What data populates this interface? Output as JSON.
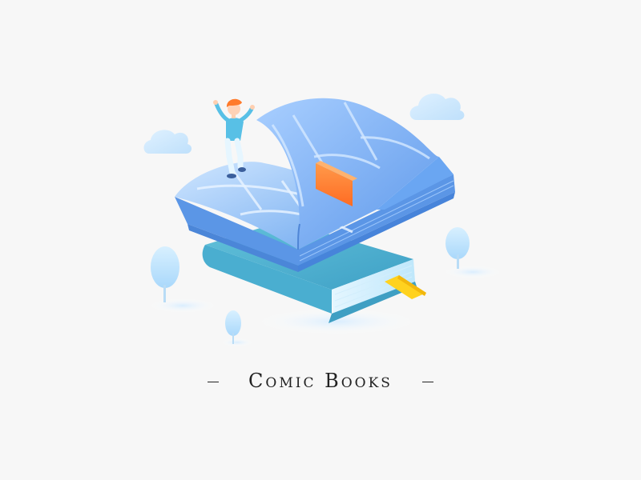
{
  "caption": {
    "title": "Comic Books"
  },
  "colors": {
    "background": "#f7f7f7",
    "book_page": "#6aa8f0",
    "book_closed": "#58bcd8",
    "page_marker": "#ff7a2a",
    "bookmark_ribbon": "#ffd21f",
    "cloud": "#cfe7fb",
    "tree": "#bfe3ff"
  },
  "icons": {
    "cloud_left": "cloud-icon",
    "cloud_right": "cloud-icon",
    "tree_left_large": "tree-icon",
    "tree_left_small": "tree-icon",
    "tree_right": "tree-icon",
    "person": "person-icon",
    "open_book": "open-book-icon",
    "closed_book": "closed-book-icon",
    "bookmark": "bookmark-icon"
  }
}
